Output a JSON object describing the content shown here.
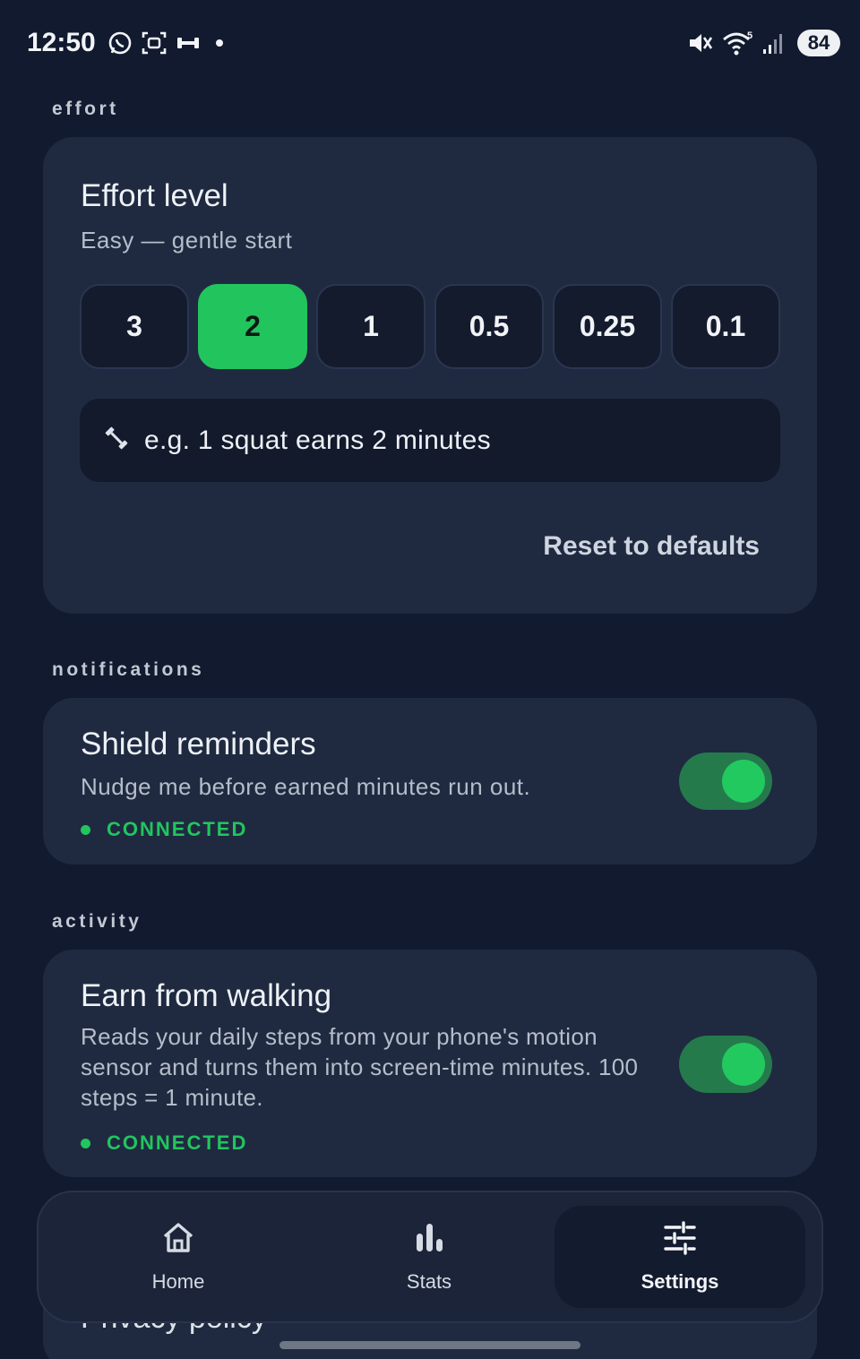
{
  "status_bar": {
    "time": "12:50",
    "left_icons": [
      "whatsapp-icon",
      "screenshot-icon",
      "dumbbell-icon",
      "dot-icon"
    ],
    "right_icons": [
      "mute-icon",
      "wifi-icon",
      "signal-icon"
    ],
    "wifi_badge": "5",
    "battery": "84"
  },
  "sections": {
    "effort": "effort",
    "notifications": "notifications",
    "activity": "activity"
  },
  "effort_card": {
    "title": "Effort level",
    "subtitle": "Easy — gentle start",
    "options": [
      "3",
      "2",
      "1",
      "0.5",
      "0.25",
      "0.1"
    ],
    "selected": "2",
    "example_icon": "dumbbell-icon",
    "example": "e.g. 1 squat earns 2 minutes",
    "reset_label": "Reset to defaults"
  },
  "shield_card": {
    "title": "Shield reminders",
    "description": "Nudge me before earned minutes run out.",
    "status": "CONNECTED",
    "enabled": true
  },
  "walking_card": {
    "title": "Earn from walking",
    "description": "Reads your daily steps from your phone's motion sensor and turns them into screen-time minutes. 100 steps = 1 minute.",
    "status": "CONNECTED",
    "enabled": true
  },
  "peek": {
    "text": "Privacy policy"
  },
  "bottom_nav": {
    "items": [
      {
        "label": "Home",
        "icon": "home-icon"
      },
      {
        "label": "Stats",
        "icon": "bar-chart-icon"
      },
      {
        "label": "Settings",
        "icon": "sliders-icon"
      }
    ],
    "active": "Settings"
  },
  "colors": {
    "background": "#111a2e",
    "card": "#1f2a40",
    "accent": "#22c55e"
  }
}
